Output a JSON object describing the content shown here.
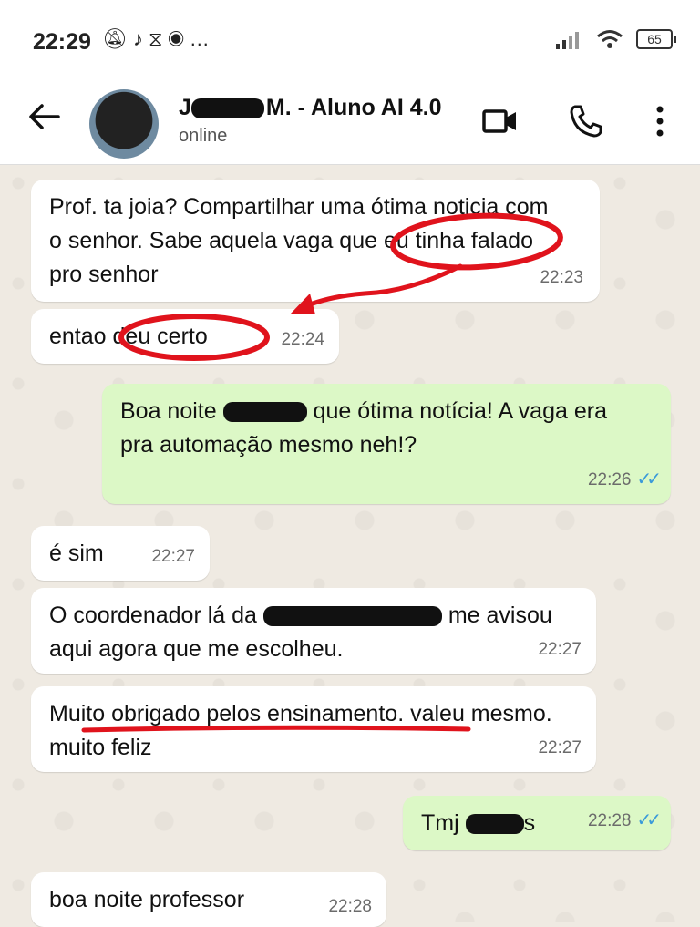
{
  "statusbar": {
    "time": "22:29",
    "icons": [
      "mute-icon",
      "tiktok-icon",
      "capcut-icon",
      "record-icon",
      "more-dots"
    ],
    "battery": "65"
  },
  "header": {
    "contact_name": "M. - Aluno AI 4.0",
    "contact_name_prefix": "J",
    "status": "online"
  },
  "messages": [
    {
      "dir": "in",
      "text": "Prof. ta joia? Compartilhar uma ótima noticia com o senhor. Sabe aquela vaga que eu tinha falado pro senhor",
      "time": "22:23"
    },
    {
      "dir": "in",
      "text": "entao deu certo",
      "time": "22:24"
    },
    {
      "dir": "out",
      "text_before": "Boa noite ",
      "text_after": " que ótima notícia! A vaga era pra automação mesmo neh!?",
      "time": "22:26"
    },
    {
      "dir": "in",
      "text": "é sim",
      "time": "22:27"
    },
    {
      "dir": "in",
      "text_before": "O coordenador lá da ",
      "text_after": " me avisou aqui agora que me escolheu.",
      "time": "22:27"
    },
    {
      "dir": "in",
      "text": "Muito obrigado pelos ensinamento. valeu mesmo. muito feliz",
      "time": "22:27"
    },
    {
      "dir": "out",
      "text_before": "Tmj ",
      "text_after": "s",
      "time": "22:28"
    },
    {
      "dir": "in",
      "text": "boa noite professor",
      "time": "22:28"
    }
  ],
  "colors": {
    "incoming": "#ffffff",
    "outgoing": "#dcf8c6",
    "annotation": "#e0131c",
    "read_ticks": "#3a9ad9"
  }
}
